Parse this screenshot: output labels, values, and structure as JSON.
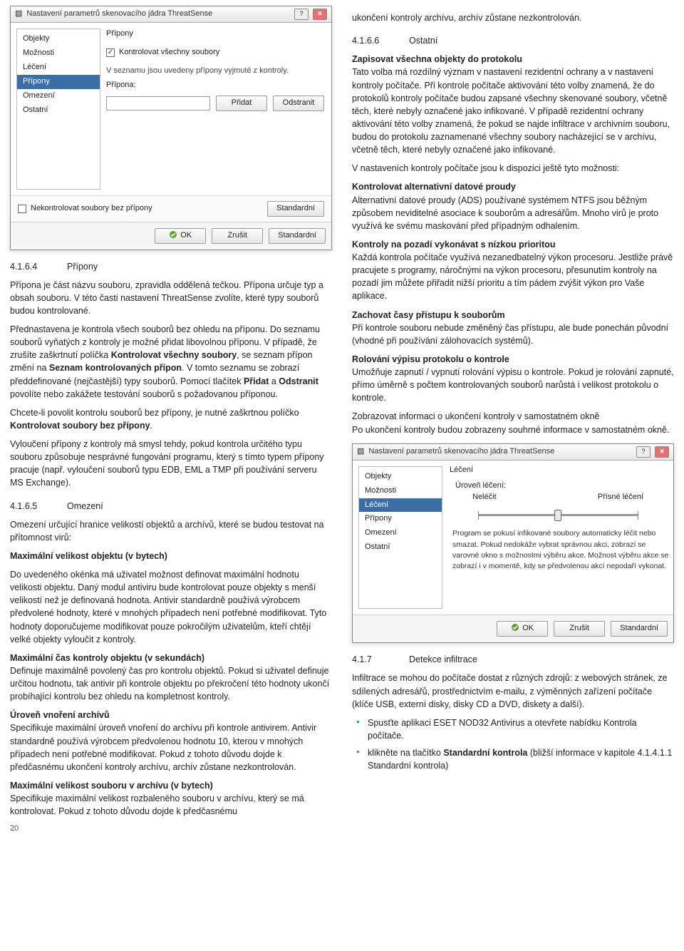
{
  "dialog1": {
    "title": "Nastavení parametrů skenovacího jádra ThreatSense",
    "sidebar": [
      "Objekty",
      "Možnosti",
      "Léčení",
      "Přípony",
      "Omezení",
      "Ostatní"
    ],
    "selectedIndex": 3,
    "group": "Přípony",
    "cb_all": "Kontrolovat všechny soubory",
    "desc": "V seznamu jsou uvedeny přípony vyjmuté z kontroly.",
    "label_pripona": "Přípona:",
    "btn_add": "Přidat",
    "btn_remove": "Odstranit",
    "cb_noext": "Nekontrolovat soubory bez přípony",
    "btn_std_inner": "Standardní",
    "btn_ok": "OK",
    "btn_cancel": "Zrušit",
    "btn_std": "Standardní"
  },
  "dialog2": {
    "title": "Nastavení parametrů skenovacího jádra ThreatSense",
    "sidebar": [
      "Objekty",
      "Možnosti",
      "Léčení",
      "Přípony",
      "Omezení",
      "Ostatní"
    ],
    "selectedIndex": 2,
    "group": "Léčení",
    "level_label": "Úroveň léčení:",
    "slider_left": "Neléčit",
    "slider_right": "Přísné léčení",
    "note": "Program se pokusí infikované soubory automaticky léčit nebo smazat. Pokud nedokáže vybrat správnou akci, zobrazí se varovné okno s možnostmi výběru akce. Možnost výběru akce se zobrazí i v momentě, kdy se předvolenou akcí nepodaří vykonat.",
    "btn_ok": "OK",
    "btn_cancel": "Zrušit",
    "btn_std": "Standardní"
  },
  "left": {
    "sec_4164_num": "4.1.6.4",
    "sec_4164_title": "Přípony",
    "p1": "Přípona je část názvu souboru, zpravidla oddělená tečkou. Přípona určuje typ a obsah souboru. V této časti nastavení ThreatSense zvolíte, které typy souborů budou kontrolované.",
    "p2a": "Přednastavena je kontrola všech souborů bez ohledu na příponu. Do seznamu souborů vyňatých z kontroly je možné přidat libovolnou příponu. V případě, že zrušíte zaškrtnutí políčka ",
    "p2b": "Kontrolovat všechny soubory",
    "p2c": ", se seznam přípon změní na ",
    "p2d": "Seznam kontrolovaných přípon",
    "p2e": ". V tomto seznamu se zobrazí předdefinované (nejčastější) typy souborů. Pomocí tlačítek ",
    "p2f": "Přidat",
    "p2g": " a ",
    "p2h": "Odstranit",
    "p2i": " povolíte nebo zakážete testování souborů s požadovanou příponou.",
    "p3a": "Chcete-li povolit kontrolu souborů bez přípony, je nutné zaškrtnou políčko ",
    "p3b": "Kontrolovat soubory bez přípony",
    "p3c": ".",
    "p4": "Vyloučení přípony z kontroly má smysl tehdy, pokud kontrola určitého typu souboru způsobuje nesprávné fungování programu, který s tímto typem přípony pracuje (např. vyloučení souborů typu EDB, EML a TMP při používání serveru MS Exchange).",
    "sec_4165_num": "4.1.6.5",
    "sec_4165_title": "Omezení",
    "p5": "Omezení určující hranice velikostí objektů a archívů, které se budou testovat na přítomnost virů:",
    "h_maxobj": "Maximální velikost objektu (v bytech)",
    "p6": "Do uvedeného okénka má uživatel možnost definovat maximální hodnotu velikosti objektu. Daný modul antiviru bude kontrolovat pouze objekty s menší velikostí než je definovaná hodnota. Antivir standardně používá výrobcem předvolené hodnoty, které v mnohých případech není potřebné modifikovat. Tyto hodnoty doporučujeme modifikovat pouze pokročilým uživatelům, kteří chtějí velké objekty vyloučit z kontroly.",
    "h_maxtime": "Maximální čas kontroly objektu (v sekundách)",
    "p7": "Definuje maximálně povolený čas pro kontrolu objektů. Pokud si uživatel definuje určitou hodnotu, tak antivir při kontrole objektu po překročení této hodnoty ukončí probíhající kontrolu bez ohledu na kompletnost kontroly.",
    "h_nesting": "Úroveň vnoření archívů",
    "p8": "Specifikuje maximální úroveň vnoření do archívu při kontrole antivirem. Antivir standardně používá výrobcem předvolenou hodnotu 10, kterou v mnohých případech není potřebné modifikovat. Pokud z tohoto důvodu dojde k předčasnému ukončení kontroly archívu, archív zůstane nezkontrolován.",
    "h_maxarch": "Maximální velikost souboru v archívu (v bytech)",
    "p9": "Specifikuje maximální velikost rozbaleného souboru v archívu, který se má kontrolovat. Pokud z tohoto důvodu dojde k předčasnému",
    "page": "20"
  },
  "right": {
    "p_top": "ukončení kontroly archívu, archív zůstane nezkontrolován.",
    "sec_4166_num": "4.1.6.6",
    "sec_4166_title": "Ostatní",
    "h_log": "Zapisovat všechna objekty do protokolu",
    "p_log": "Tato volba má rozdílný význam v nastavení rezidentní ochrany a v nastavení kontroly počítače. Při kontrole počítače aktivování této volby znamená, že do protokolů kontroly počítače budou zapsané všechny skenované soubory, včetně těch, které nebyly označené jako infikované. V případě rezidentní ochrany aktivování této volby znamená, že pokud se najde infiltrace v archivním souboru, budou do protokolu zaznamenané všechny soubory nacházející se v archívu, včetně těch, které nebyly označené jako infikované.",
    "p_more": "V nastaveních kontroly počítače jsou k dispozici ještě tyto možnosti:",
    "h_ads": "Kontrolovat alternativní datové proudy",
    "p_ads": "Alternativní datové proudy (ADS) používané systémem NTFS jsou běžným způsobem neviditelné asociace k souborům a adresářům. Mnoho virů je proto využívá ke svému maskování před případným odhalením.",
    "h_bg": "Kontroly na pozadí vykonávat s nízkou prioritou",
    "p_bg": "Každá kontrola počítače využívá nezanedbatelný výkon procesoru. Jestliže právě pracujete s programy, náročnými na výkon procesoru, přesunutím kontroly na pozadí jim můžete přiřadit nižší prioritu a tím pádem zvýšit výkon pro Vaše aplikace.",
    "h_times": "Zachovat časy přístupu k souborům",
    "p_times": "Při kontrole souboru nebude změněný čas přístupu, ale bude ponechán původní (vhodné při používání zálohovacích systémů).",
    "h_roll": "Rolování výpisu protokolu o kontrole",
    "p_roll": "Umožňuje zapnutí / vypnutí rolování výpisu o kontrole. Pokud je rolování zapnuté, přímo úměrně s počtem kontrolovaných souborů narůstá i velikost protokolu o kontrole.",
    "h_window": "Zobrazovat informaci o ukončení kontroly v samostatném okně",
    "p_window": "Po ukončení kontroly budou zobrazeny souhrné informace v samostatném okně.",
    "sec_417_num": "4.1.7",
    "sec_417_title": "Detekce infiltrace",
    "p_inf": "Infiltrace se mohou do počítače dostat z různých zdrojů: z webových stránek, ze sdílených adresářů, prostřednictvím e-mailu, z výměnných zařízení počítače (klíče USB, externí disky, disky CD a DVD, diskety a další).",
    "b1": "Spusťte aplikaci ESET NOD32 Antivirus a otevřete nabídku Kontrola počítače.",
    "b2a": "klikněte na tlačítko ",
    "b2b": "Standardní kontrola",
    "b2c": " (bližší informace v kapitole 4.1.4.1.1 Standardní kontrola)"
  }
}
